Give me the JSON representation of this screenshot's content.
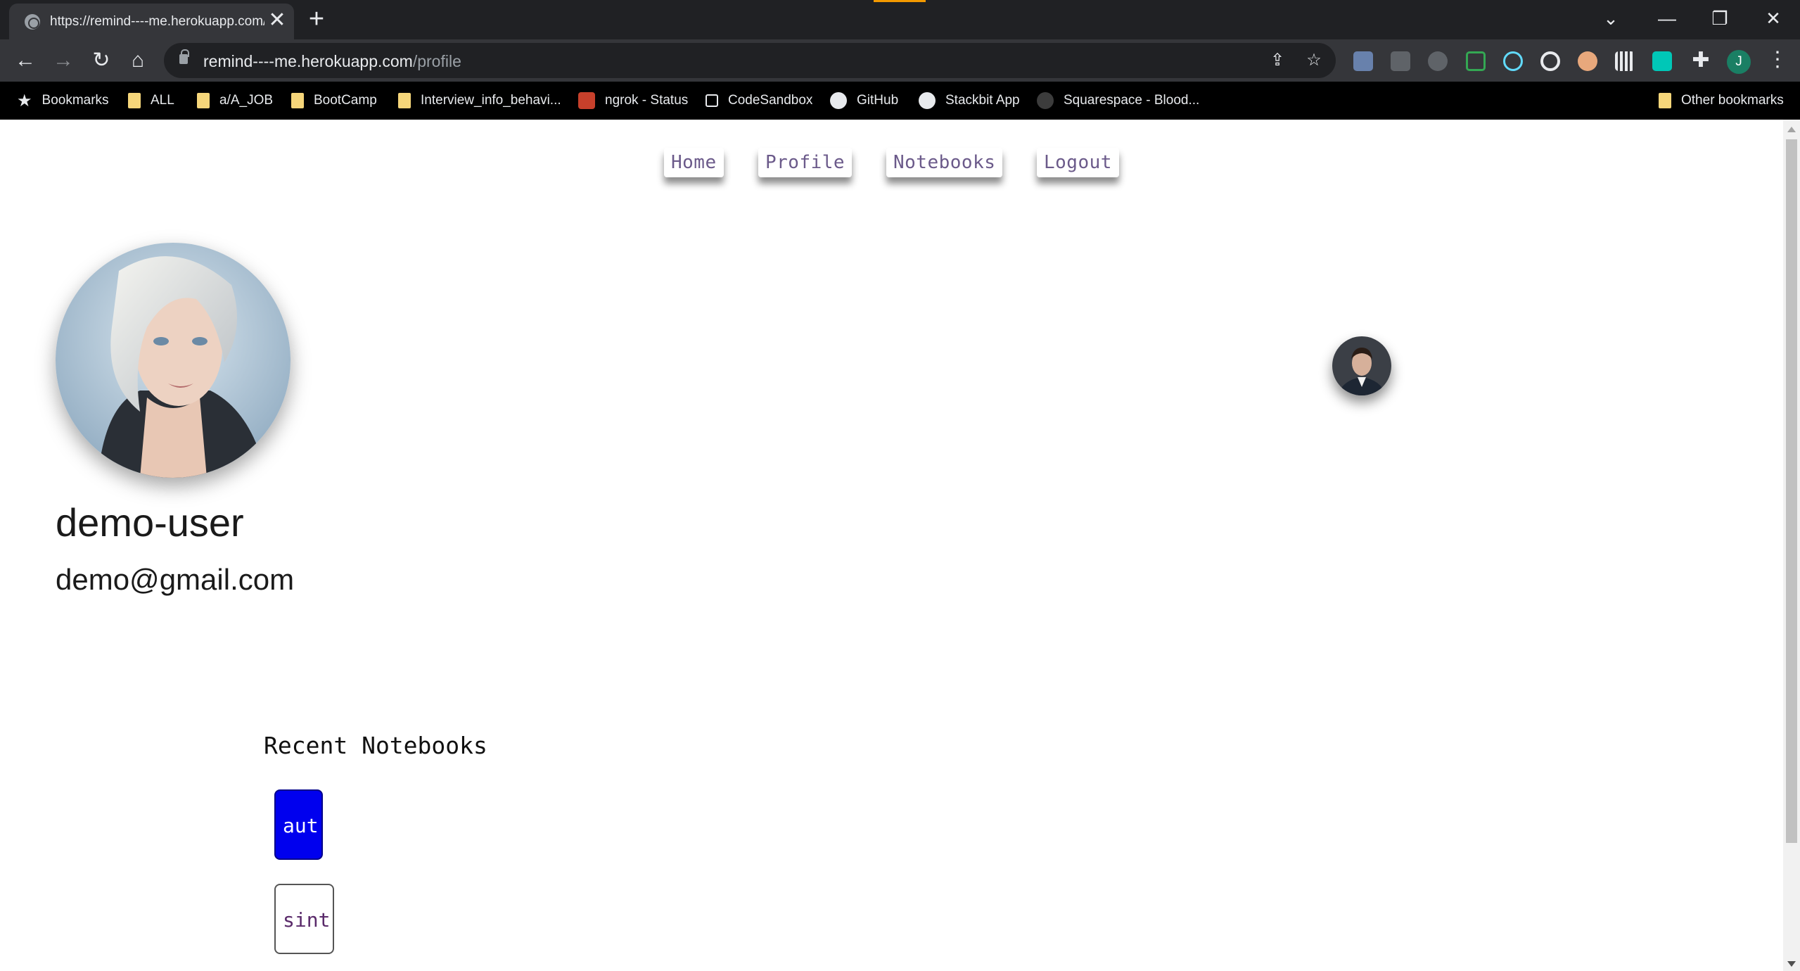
{
  "browser": {
    "tab_title": "https://remind----me.herokuapp.com/profile",
    "tab_close": "✕",
    "new_tab": "+",
    "url_host": "remind----me.herokuapp.com",
    "url_path": "/profile",
    "window_controls": {
      "down": "⌄",
      "minimize": "—",
      "restore": "❐",
      "close": "✕"
    },
    "profile_initial": "J",
    "bookmarks": [
      {
        "label": "Bookmarks",
        "icon": "star-icon"
      },
      {
        "label": "ALL",
        "icon": "folder-icon"
      },
      {
        "label": "a/A_JOB",
        "icon": "folder-icon"
      },
      {
        "label": "BootCamp",
        "icon": "folder-icon"
      },
      {
        "label": "Interview_info_behavi...",
        "icon": "folder-icon"
      },
      {
        "label": "ngrok - Status",
        "icon": "ngrok-icon"
      },
      {
        "label": "CodeSandbox",
        "icon": "codesandbox-icon"
      },
      {
        "label": "GitHub",
        "icon": "github-icon"
      },
      {
        "label": "Stackbit App",
        "icon": "stackbit-icon"
      },
      {
        "label": "Squarespace - Blood...",
        "icon": "squarespace-icon"
      }
    ],
    "other_bookmarks": "Other bookmarks"
  },
  "nav": {
    "home": "Home",
    "profile": "Profile",
    "notebooks": "Notebooks",
    "logout": "Logout"
  },
  "profile": {
    "username": "demo-user",
    "email": "demo@gmail.com"
  },
  "recent": {
    "title": "Recent Notebooks",
    "notebooks": [
      "aut",
      "sint"
    ]
  },
  "colors": {
    "notebook_active": "#0000ee",
    "nav_text": "#6b5a8a",
    "chrome_dark": "#202124",
    "toolbar": "#35363a"
  }
}
